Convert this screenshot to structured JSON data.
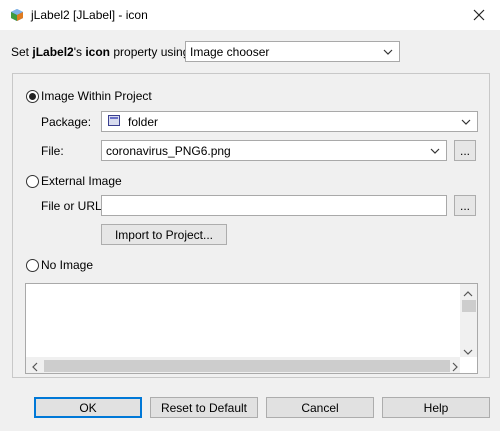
{
  "window": {
    "title": "jLabel2 [JLabel] - icon",
    "close_label": "✕"
  },
  "property_row": {
    "prefix": "Set ",
    "component": "jLabel2",
    "possessive": "'s ",
    "property": "icon",
    "suffix": " property using:",
    "mode_value": "Image chooser"
  },
  "options": {
    "within_project": {
      "label": "Image Within Project",
      "selected": true,
      "package_label": "Package:",
      "package_value": "folder",
      "file_label": "File:",
      "file_value": "coronavirus_PNG6.png",
      "browse_label": "..."
    },
    "external": {
      "label": "External Image",
      "selected": false,
      "url_label": "File or URL:",
      "url_value": "",
      "browse_label": "...",
      "import_label": "Import to Project..."
    },
    "none": {
      "label": "No Image",
      "selected": false
    }
  },
  "buttons": {
    "ok": "OK",
    "reset": "Reset to Default",
    "cancel": "Cancel",
    "help": "Help"
  },
  "colors": {
    "accent": "#0078d7",
    "dialog_bg": "#f0f0f0"
  },
  "icons": {
    "app": "netbeans-cube-icon",
    "package": "package-icon"
  }
}
